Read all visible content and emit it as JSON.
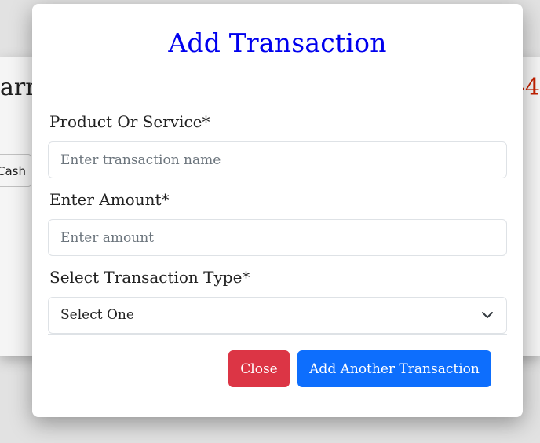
{
  "background": {
    "left_text": "arn",
    "right_text": "-4",
    "cash_button": "Cash"
  },
  "modal": {
    "title": "Add Transaction",
    "fields": {
      "product": {
        "label": "Product Or Service*",
        "placeholder": "Enter transaction name",
        "value": ""
      },
      "amount": {
        "label": "Enter Amount*",
        "placeholder": "Enter amount",
        "value": ""
      },
      "type": {
        "label": "Select Transaction Type*",
        "selected": "Select One"
      }
    },
    "buttons": {
      "close": "Close",
      "add_another": "Add Another Transaction"
    }
  },
  "colors": {
    "title": "#0000ee",
    "close_button": "#dc3545",
    "primary_button": "#0d6efd",
    "accent_red": "#cc2200"
  },
  "icons": {
    "select_chevron": "chevron-down-icon"
  }
}
